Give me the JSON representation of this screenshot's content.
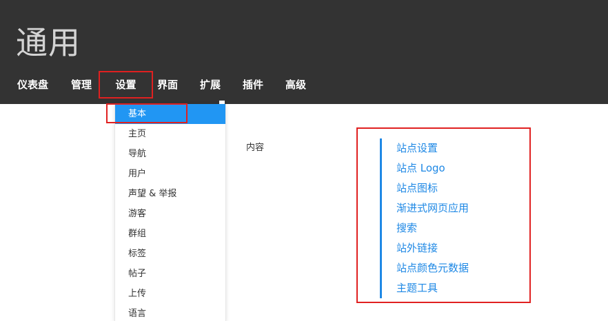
{
  "header": {
    "title": "通用"
  },
  "nav": {
    "items": [
      {
        "label": "仪表盘"
      },
      {
        "label": "管理"
      },
      {
        "label": "设置",
        "active": true
      },
      {
        "label": "界面"
      },
      {
        "label": "扩展"
      },
      {
        "label": "插件"
      },
      {
        "label": "高级"
      }
    ]
  },
  "settings_menu": {
    "items": [
      {
        "label": "基本",
        "selected": true
      },
      {
        "label": "主页"
      },
      {
        "label": "导航"
      },
      {
        "label": "用户"
      },
      {
        "label": "声望 & 举报"
      },
      {
        "label": "游客"
      },
      {
        "label": "群组"
      },
      {
        "label": "标签"
      },
      {
        "label": "帖子"
      },
      {
        "label": "上传"
      },
      {
        "label": "语言"
      }
    ]
  },
  "main": {
    "content_label": "内容",
    "sections": [
      {
        "label": "站点设置"
      },
      {
        "label": "站点 Logo"
      },
      {
        "label": "站点图标"
      },
      {
        "label": "渐进式网页应用"
      },
      {
        "label": "搜索"
      },
      {
        "label": "站外链接"
      },
      {
        "label": "站点颜色元数据"
      },
      {
        "label": "主题工具"
      }
    ]
  },
  "colors": {
    "header_bg": "#333333",
    "accent": "#2196f3",
    "link": "#1e88e5",
    "highlight_box": "#e02020"
  }
}
